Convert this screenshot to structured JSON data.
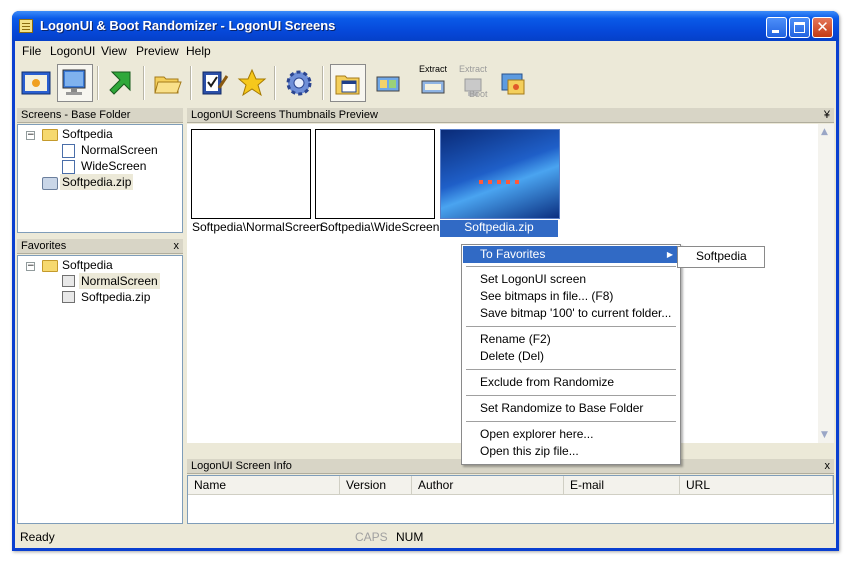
{
  "window": {
    "title": "LogonUI & Boot Randomizer - LogonUI Screens"
  },
  "menu": [
    "File",
    "LogonUI",
    "View",
    "Preview",
    "Help"
  ],
  "toolbar": {
    "extract_label": "Extract",
    "extract_boot_label": "Extract",
    "extract_boot_sub": "Boot"
  },
  "screens_panel": {
    "title": "Screens - Base Folder",
    "root": "Softpedia",
    "children": [
      "NormalScreen",
      "WideScreen"
    ],
    "zip": "Softpedia.zip"
  },
  "favorites_panel": {
    "title": "Favorites",
    "close": "x",
    "root": "Softpedia",
    "children": [
      "NormalScreen",
      "Softpedia.zip"
    ]
  },
  "thumbnails_panel": {
    "title": "LogonUI Screens Thumbnails Preview",
    "pin": "¥",
    "items": [
      "Softpedia\\NormalScreen",
      "Softpedia\\WideScreen",
      "Softpedia.zip"
    ]
  },
  "context_menu": {
    "items": [
      "To Favorites",
      "Set LogonUI screen",
      "See bitmaps in file... (F8)",
      "Save bitmap '100' to current folder...",
      "Rename (F2)",
      "Delete (Del)",
      "Exclude from Randomize",
      "Set Randomize to Base Folder",
      "Open explorer here...",
      "Open this zip file..."
    ],
    "submenu_item": "Softpedia"
  },
  "info_panel": {
    "title": "LogonUI Screen Info",
    "close": "x",
    "columns": [
      "Name",
      "Version",
      "Author",
      "E-mail",
      "URL"
    ]
  },
  "status": {
    "ready": "Ready",
    "caps": "CAPS",
    "num": "NUM"
  },
  "colors": {
    "titlebar": "#0a5ae8",
    "selection": "#316ac5",
    "face": "#ece9d8"
  }
}
